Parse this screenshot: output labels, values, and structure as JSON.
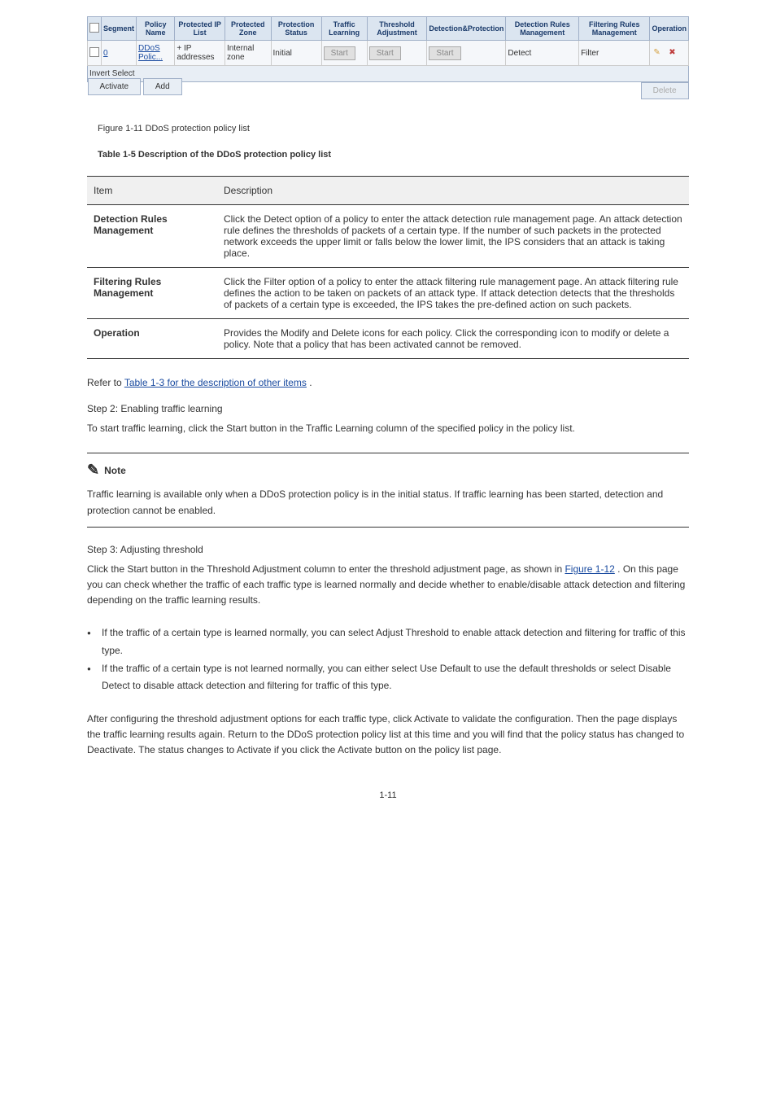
{
  "screenshot": {
    "headers": [
      "",
      "Segment",
      "Policy Name",
      "Protected IP List",
      "Protected Zone",
      "Protection Status",
      "Traffic Learning",
      "Threshold Adjustment",
      "Detection&Protection",
      "Detection Rules Management",
      "Filtering Rules Management",
      "Operation"
    ],
    "row": {
      "segment": "0",
      "policy_name": "DDoS Polic...",
      "ip_list": "+ IP addresses",
      "zone": "Internal zone",
      "status": "Initial",
      "traffic": "Start",
      "threshold": "Start",
      "detect_prot": "Start",
      "detect_rules": "Detect",
      "filter_rules": "Filter"
    },
    "invert": "Invert Select",
    "activate": "Activate",
    "add": "Add",
    "delete": "Delete"
  },
  "figure_caption": "Figure 1-11 DDoS protection policy list",
  "table_caption": "Table 1-5 Description of the DDoS protection policy list",
  "data_table": {
    "headers": [
      "Item",
      "Description"
    ],
    "rows": [
      {
        "item": "Detection Rules Management",
        "desc": "Click the Detect option of a policy to enter the attack detection rule management page. An attack detection rule defines the thresholds of packets of a certain type. If the number of such packets in the protected network exceeds the upper limit or falls below the lower limit, the IPS considers that an attack is taking place."
      },
      {
        "item": "Filtering Rules Management",
        "desc": "Click the Filter option of a policy to enter the attack filtering rule management page. An attack filtering rule defines the action to be taken on packets of an attack type. If attack detection detects that the thresholds of packets of a certain type is exceeded, the IPS takes the pre-defined action on such packets."
      },
      {
        "item": "Operation",
        "desc": "Provides the Modify and Delete icons for each policy. Click the corresponding icon to modify or delete a policy. Note that a policy that has been activated cannot be removed."
      }
    ]
  },
  "refer": {
    "text_before": "Refer to ",
    "link": "Table 1-3 for the description of other items",
    "text_after": "."
  },
  "step2": {
    "title": "Step 2: Enabling traffic learning",
    "body": "To start traffic learning, click the Start button in the Traffic Learning column of the specified policy in the policy list."
  },
  "note": {
    "label": "Note",
    "body": "Traffic learning is available only when a DDoS protection policy is in the initial status. If traffic learning has been started, detection and protection cannot be enabled."
  },
  "step3": {
    "title": "Step 3: Adjusting threshold",
    "body_before": "Click the Start button in the Threshold Adjustment column to enter the threshold adjustment page, as shown in ",
    "body_link": "Figure 1-12",
    "body_after": ". On this page you can check whether the traffic of each traffic type is learned normally and decide whether to enable/disable attack detection and filtering depending on the traffic learning results."
  },
  "bullets": [
    "If the traffic of a certain type is learned normally, you can select Adjust Threshold to enable attack detection and filtering for traffic of this type.",
    "If the traffic of a certain type is not learned normally, you can either select Use Default to use the default thresholds or select Disable Detect to disable attack detection and filtering for traffic of this type."
  ],
  "after_bullets": "After configuring the threshold adjustment options for each traffic type, click Activate to validate the configuration. Then the page displays the traffic learning results again. Return to the DDoS protection policy list at this time and you will find that the policy status has changed to Deactivate. The status changes to Activate if you click the Activate button on the policy list page.",
  "page_num": "1-11"
}
